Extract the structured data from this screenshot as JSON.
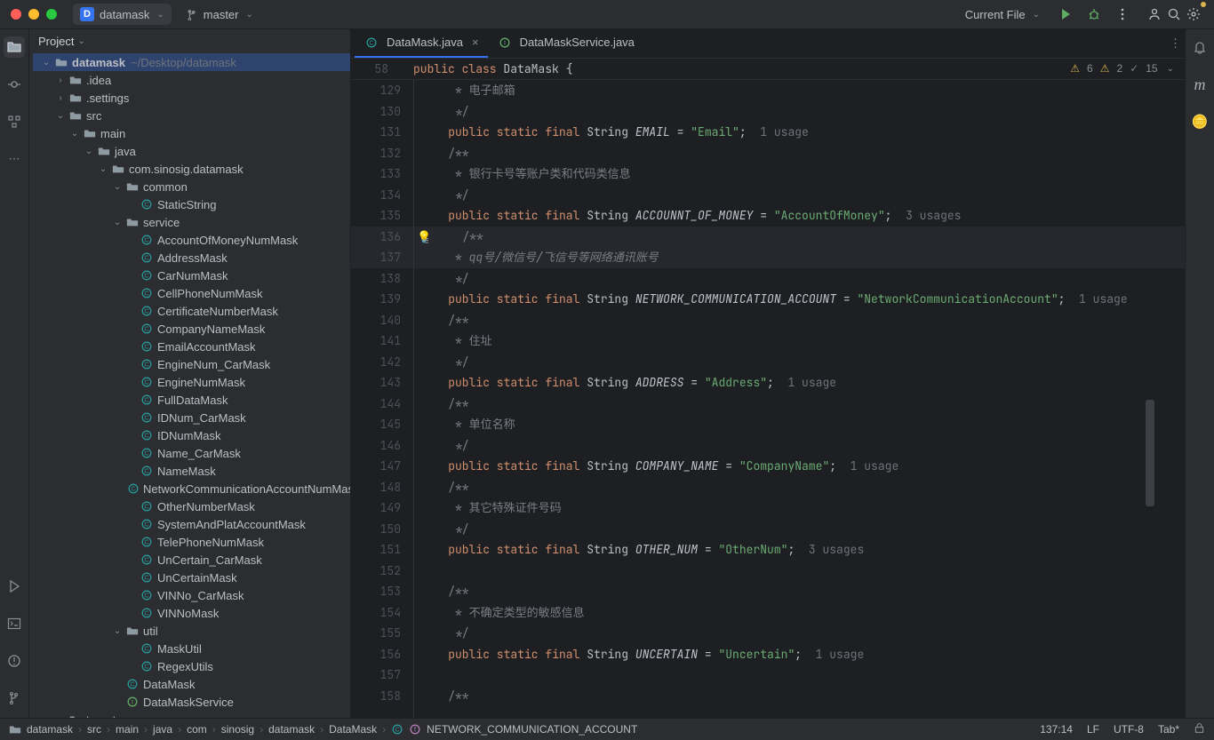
{
  "titlebar": {
    "project_badge_letter": "D",
    "project_name": "datamask",
    "branch": "master",
    "run_config": "Current File"
  },
  "project_panel": {
    "title": "Project",
    "root_label": "datamask",
    "root_hint": "~/Desktop/datamask",
    "tree": [
      {
        "d": 0,
        "tw": "v",
        "icon": "folder",
        "label": "datamask",
        "hint": "~/Desktop/datamask",
        "bold": true,
        "sel": true
      },
      {
        "d": 1,
        "tw": ">",
        "icon": "folder",
        "label": ".idea"
      },
      {
        "d": 1,
        "tw": ">",
        "icon": "folder",
        "label": ".settings"
      },
      {
        "d": 1,
        "tw": "v",
        "icon": "folder",
        "label": "src"
      },
      {
        "d": 2,
        "tw": "v",
        "icon": "folder",
        "label": "main"
      },
      {
        "d": 3,
        "tw": "v",
        "icon": "folder",
        "label": "java"
      },
      {
        "d": 4,
        "tw": "v",
        "icon": "folder",
        "label": "com.sinosig.datamask"
      },
      {
        "d": 5,
        "tw": "v",
        "icon": "folder",
        "label": "common"
      },
      {
        "d": 6,
        "tw": "",
        "icon": "class",
        "label": "StaticString"
      },
      {
        "d": 5,
        "tw": "v",
        "icon": "folder",
        "label": "service"
      },
      {
        "d": 6,
        "tw": "",
        "icon": "class",
        "label": "AccountOfMoneyNumMask"
      },
      {
        "d": 6,
        "tw": "",
        "icon": "class",
        "label": "AddressMask"
      },
      {
        "d": 6,
        "tw": "",
        "icon": "class",
        "label": "CarNumMask"
      },
      {
        "d": 6,
        "tw": "",
        "icon": "class",
        "label": "CellPhoneNumMask"
      },
      {
        "d": 6,
        "tw": "",
        "icon": "class",
        "label": "CertificateNumberMask"
      },
      {
        "d": 6,
        "tw": "",
        "icon": "class",
        "label": "CompanyNameMask"
      },
      {
        "d": 6,
        "tw": "",
        "icon": "class",
        "label": "EmailAccountMask"
      },
      {
        "d": 6,
        "tw": "",
        "icon": "class",
        "label": "EngineNum_CarMask"
      },
      {
        "d": 6,
        "tw": "",
        "icon": "class",
        "label": "EngineNumMask"
      },
      {
        "d": 6,
        "tw": "",
        "icon": "class",
        "label": "FullDataMask"
      },
      {
        "d": 6,
        "tw": "",
        "icon": "class",
        "label": "IDNum_CarMask"
      },
      {
        "d": 6,
        "tw": "",
        "icon": "class",
        "label": "IDNumMask"
      },
      {
        "d": 6,
        "tw": "",
        "icon": "class",
        "label": "Name_CarMask"
      },
      {
        "d": 6,
        "tw": "",
        "icon": "class",
        "label": "NameMask"
      },
      {
        "d": 6,
        "tw": "",
        "icon": "class",
        "label": "NetworkCommunicationAccountNumMask"
      },
      {
        "d": 6,
        "tw": "",
        "icon": "class",
        "label": "OtherNumberMask"
      },
      {
        "d": 6,
        "tw": "",
        "icon": "class",
        "label": "SystemAndPlatAccountMask"
      },
      {
        "d": 6,
        "tw": "",
        "icon": "class",
        "label": "TelePhoneNumMask"
      },
      {
        "d": 6,
        "tw": "",
        "icon": "class",
        "label": "UnCertain_CarMask"
      },
      {
        "d": 6,
        "tw": "",
        "icon": "class",
        "label": "UnCertainMask"
      },
      {
        "d": 6,
        "tw": "",
        "icon": "class",
        "label": "VINNo_CarMask"
      },
      {
        "d": 6,
        "tw": "",
        "icon": "class",
        "label": "VINNoMask"
      },
      {
        "d": 5,
        "tw": "v",
        "icon": "folder",
        "label": "util"
      },
      {
        "d": 6,
        "tw": "",
        "icon": "class",
        "label": "MaskUtil"
      },
      {
        "d": 6,
        "tw": "",
        "icon": "class",
        "label": "RegexUtils"
      },
      {
        "d": 5,
        "tw": "",
        "icon": "class",
        "label": "DataMask"
      },
      {
        "d": 5,
        "tw": "",
        "icon": "classg",
        "label": "DataMaskService"
      },
      {
        "d": 1,
        "tw": ">",
        "icon": "folder",
        "label": "target"
      }
    ]
  },
  "tabs": [
    {
      "label": "DataMask.java",
      "icon": "class",
      "active": true,
      "close": true
    },
    {
      "label": "DataMaskService.java",
      "icon": "classg",
      "active": false,
      "close": false
    }
  ],
  "sticky": {
    "lineno": "58",
    "tokens": [
      {
        "t": "public ",
        "c": "kw"
      },
      {
        "t": "class ",
        "c": "kw"
      },
      {
        "t": "DataMask ",
        "c": "cls"
      },
      {
        "t": "{",
        "c": ""
      }
    ]
  },
  "inspections": {
    "warn1": "6",
    "warn2": "2",
    "check": "15"
  },
  "code_lines": [
    {
      "n": 129,
      "tok": [
        {
          "t": "     * 电子邮箱",
          "c": "comment"
        }
      ]
    },
    {
      "n": 130,
      "tok": [
        {
          "t": "     */",
          "c": "comment"
        }
      ]
    },
    {
      "n": 131,
      "tok": [
        {
          "t": "    ",
          "c": ""
        },
        {
          "t": "public static final ",
          "c": "kw"
        },
        {
          "t": "String ",
          "c": "type"
        },
        {
          "t": "EMAIL",
          "c": "italic"
        },
        {
          "t": " = ",
          "c": ""
        },
        {
          "t": "\"Email\"",
          "c": "str"
        },
        {
          "t": ";  ",
          "c": ""
        },
        {
          "t": "1 usage",
          "c": "usage"
        }
      ]
    },
    {
      "n": 132,
      "tok": [
        {
          "t": "    /**",
          "c": "comment"
        }
      ]
    },
    {
      "n": 133,
      "tok": [
        {
          "t": "     * 银行卡号等账户类和代码类信息",
          "c": "comment"
        }
      ]
    },
    {
      "n": 134,
      "tok": [
        {
          "t": "     */",
          "c": "comment"
        }
      ]
    },
    {
      "n": 135,
      "tok": [
        {
          "t": "    ",
          "c": ""
        },
        {
          "t": "public static final ",
          "c": "kw"
        },
        {
          "t": "String ",
          "c": "type"
        },
        {
          "t": "ACCOUNNT_OF_MONEY",
          "c": "italic"
        },
        {
          "t": " = ",
          "c": ""
        },
        {
          "t": "\"AccountOfMoney\"",
          "c": "str"
        },
        {
          "t": ";  ",
          "c": ""
        },
        {
          "t": "3 usages",
          "c": "usage"
        }
      ]
    },
    {
      "n": 136,
      "tok": [
        {
          "t": "    /**",
          "c": "comment"
        }
      ],
      "hl": true,
      "bulb": true,
      "gutterHint": "≡"
    },
    {
      "n": 137,
      "tok": [
        {
          "t": "     * ",
          "c": "comment"
        },
        {
          "t": "qq号/微信号/飞信号等网络通讯账号",
          "c": "comment italic"
        }
      ],
      "hl": true
    },
    {
      "n": 138,
      "tok": [
        {
          "t": "     */",
          "c": "comment"
        }
      ]
    },
    {
      "n": 139,
      "tok": [
        {
          "t": "    ",
          "c": ""
        },
        {
          "t": "public static final ",
          "c": "kw"
        },
        {
          "t": "String ",
          "c": "type"
        },
        {
          "t": "NETWORK_COMMUNICATION_ACCOUNT",
          "c": "italic"
        },
        {
          "t": " = ",
          "c": ""
        },
        {
          "t": "\"NetworkCommunicationAccount\"",
          "c": "str"
        },
        {
          "t": ";  ",
          "c": ""
        },
        {
          "t": "1 usage",
          "c": "usage"
        }
      ]
    },
    {
      "n": 140,
      "tok": [
        {
          "t": "    /**",
          "c": "comment"
        }
      ]
    },
    {
      "n": 141,
      "tok": [
        {
          "t": "     * 住址",
          "c": "comment"
        }
      ]
    },
    {
      "n": 142,
      "tok": [
        {
          "t": "     */",
          "c": "comment"
        }
      ]
    },
    {
      "n": 143,
      "tok": [
        {
          "t": "    ",
          "c": ""
        },
        {
          "t": "public static final ",
          "c": "kw"
        },
        {
          "t": "String ",
          "c": "type"
        },
        {
          "t": "ADDRESS",
          "c": "italic"
        },
        {
          "t": " = ",
          "c": ""
        },
        {
          "t": "\"Address\"",
          "c": "str"
        },
        {
          "t": ";  ",
          "c": ""
        },
        {
          "t": "1 usage",
          "c": "usage"
        }
      ]
    },
    {
      "n": 144,
      "tok": [
        {
          "t": "    /**",
          "c": "comment"
        }
      ]
    },
    {
      "n": 145,
      "tok": [
        {
          "t": "     * 单位名称",
          "c": "comment"
        }
      ]
    },
    {
      "n": 146,
      "tok": [
        {
          "t": "     */",
          "c": "comment"
        }
      ]
    },
    {
      "n": 147,
      "tok": [
        {
          "t": "    ",
          "c": ""
        },
        {
          "t": "public static final ",
          "c": "kw"
        },
        {
          "t": "String ",
          "c": "type"
        },
        {
          "t": "COMPANY_NAME",
          "c": "italic"
        },
        {
          "t": " = ",
          "c": ""
        },
        {
          "t": "\"CompanyName\"",
          "c": "str"
        },
        {
          "t": ";  ",
          "c": ""
        },
        {
          "t": "1 usage",
          "c": "usage"
        }
      ]
    },
    {
      "n": 148,
      "tok": [
        {
          "t": "    /**",
          "c": "comment"
        }
      ]
    },
    {
      "n": 149,
      "tok": [
        {
          "t": "     * 其它特殊证件号码",
          "c": "comment"
        }
      ]
    },
    {
      "n": 150,
      "tok": [
        {
          "t": "     */",
          "c": "comment"
        }
      ]
    },
    {
      "n": 151,
      "tok": [
        {
          "t": "    ",
          "c": ""
        },
        {
          "t": "public static final ",
          "c": "kw"
        },
        {
          "t": "String ",
          "c": "type"
        },
        {
          "t": "OTHER_NUM",
          "c": "italic"
        },
        {
          "t": " = ",
          "c": ""
        },
        {
          "t": "\"OtherNum\"",
          "c": "str"
        },
        {
          "t": ";  ",
          "c": ""
        },
        {
          "t": "3 usages",
          "c": "usage"
        }
      ]
    },
    {
      "n": 152,
      "tok": [
        {
          "t": "",
          "c": ""
        }
      ]
    },
    {
      "n": 153,
      "tok": [
        {
          "t": "    /**",
          "c": "comment"
        }
      ]
    },
    {
      "n": 154,
      "tok": [
        {
          "t": "     * 不确定类型的敏感信息",
          "c": "comment"
        }
      ]
    },
    {
      "n": 155,
      "tok": [
        {
          "t": "     */",
          "c": "comment"
        }
      ]
    },
    {
      "n": 156,
      "tok": [
        {
          "t": "    ",
          "c": ""
        },
        {
          "t": "public static final ",
          "c": "kw"
        },
        {
          "t": "String ",
          "c": "type"
        },
        {
          "t": "UNCERTAIN",
          "c": "italic"
        },
        {
          "t": " = ",
          "c": ""
        },
        {
          "t": "\"Uncertain\"",
          "c": "str"
        },
        {
          "t": ";  ",
          "c": ""
        },
        {
          "t": "1 usage",
          "c": "usage"
        }
      ]
    },
    {
      "n": 157,
      "tok": [
        {
          "t": "",
          "c": ""
        }
      ]
    },
    {
      "n": 158,
      "tok": [
        {
          "t": "    /**",
          "c": "comment"
        }
      ]
    }
  ],
  "breadcrumb": [
    "datamask",
    "src",
    "main",
    "java",
    "com",
    "sinosig",
    "datamask",
    "DataMask",
    "NETWORK_COMMUNICATION_ACCOUNT"
  ],
  "statusbar": {
    "pos": "137:14",
    "line_sep": "LF",
    "encoding": "UTF-8",
    "indent": "Tab*"
  }
}
